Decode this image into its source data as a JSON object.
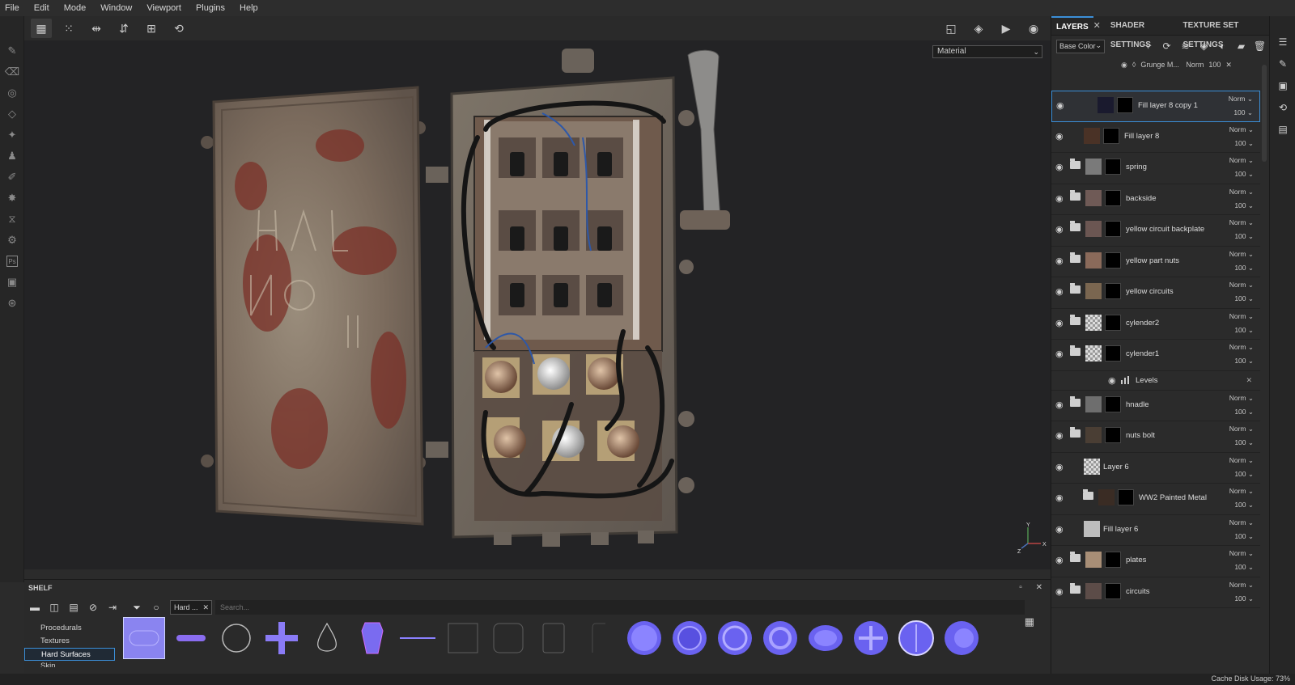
{
  "menu": [
    "File",
    "Edit",
    "Mode",
    "Window",
    "Viewport",
    "Plugins",
    "Help"
  ],
  "viewport": {
    "material_mode": "Material"
  },
  "panel": {
    "tabs": [
      "LAYERS",
      "SHADER SETTINGS",
      "TEXTURE SET SETTINGS"
    ],
    "channel": "Base Color",
    "grunge": {
      "name": "Grunge M...",
      "blend": "Norm",
      "opacity": "100"
    },
    "layers": [
      {
        "name": "Fill layer 8 copy 1",
        "blend": "Norm",
        "opacity": "100",
        "folder": false,
        "selected": true
      },
      {
        "name": "Fill layer 8",
        "blend": "Norm",
        "opacity": "100",
        "folder": false
      },
      {
        "name": "spring",
        "blend": "Norm",
        "opacity": "100",
        "folder": true
      },
      {
        "name": "backside",
        "blend": "Norm",
        "opacity": "100",
        "folder": true
      },
      {
        "name": "yellow circuit backplate",
        "blend": "Norm",
        "opacity": "100",
        "folder": true
      },
      {
        "name": "yellow part nuts",
        "blend": "Norm",
        "opacity": "100",
        "folder": true
      },
      {
        "name": "yellow circuits",
        "blend": "Norm",
        "opacity": "100",
        "folder": true
      },
      {
        "name": "cylender2",
        "blend": "Norm",
        "opacity": "100",
        "folder": true
      },
      {
        "name": "cylender1",
        "blend": "Norm",
        "opacity": "100",
        "folder": true
      },
      {
        "name": "hnadle",
        "blend": "Norm",
        "opacity": "100",
        "folder": true
      },
      {
        "name": "nuts bolt",
        "blend": "Norm",
        "opacity": "100",
        "folder": true
      },
      {
        "name": "Layer 6",
        "blend": "Norm",
        "opacity": "100",
        "folder": false
      },
      {
        "name": "WW2 Painted Metal",
        "blend": "Norm",
        "opacity": "100",
        "folder": true
      },
      {
        "name": "Fill layer 6",
        "blend": "Norm",
        "opacity": "100",
        "folder": false
      },
      {
        "name": "plates",
        "blend": "Norm",
        "opacity": "100",
        "folder": true
      },
      {
        "name": "circuits",
        "blend": "Norm",
        "opacity": "100",
        "folder": true
      }
    ],
    "levels_label": "Levels"
  },
  "shelf": {
    "title": "SHELF",
    "filter_chip": "Hard ...",
    "search_placeholder": "Search...",
    "categories": [
      "Procedurals",
      "Textures",
      "Hard Surfaces",
      "Skin"
    ],
    "active_category": "Hard Surfaces"
  },
  "status": {
    "cache": "Cache Disk Usage:   73%"
  }
}
